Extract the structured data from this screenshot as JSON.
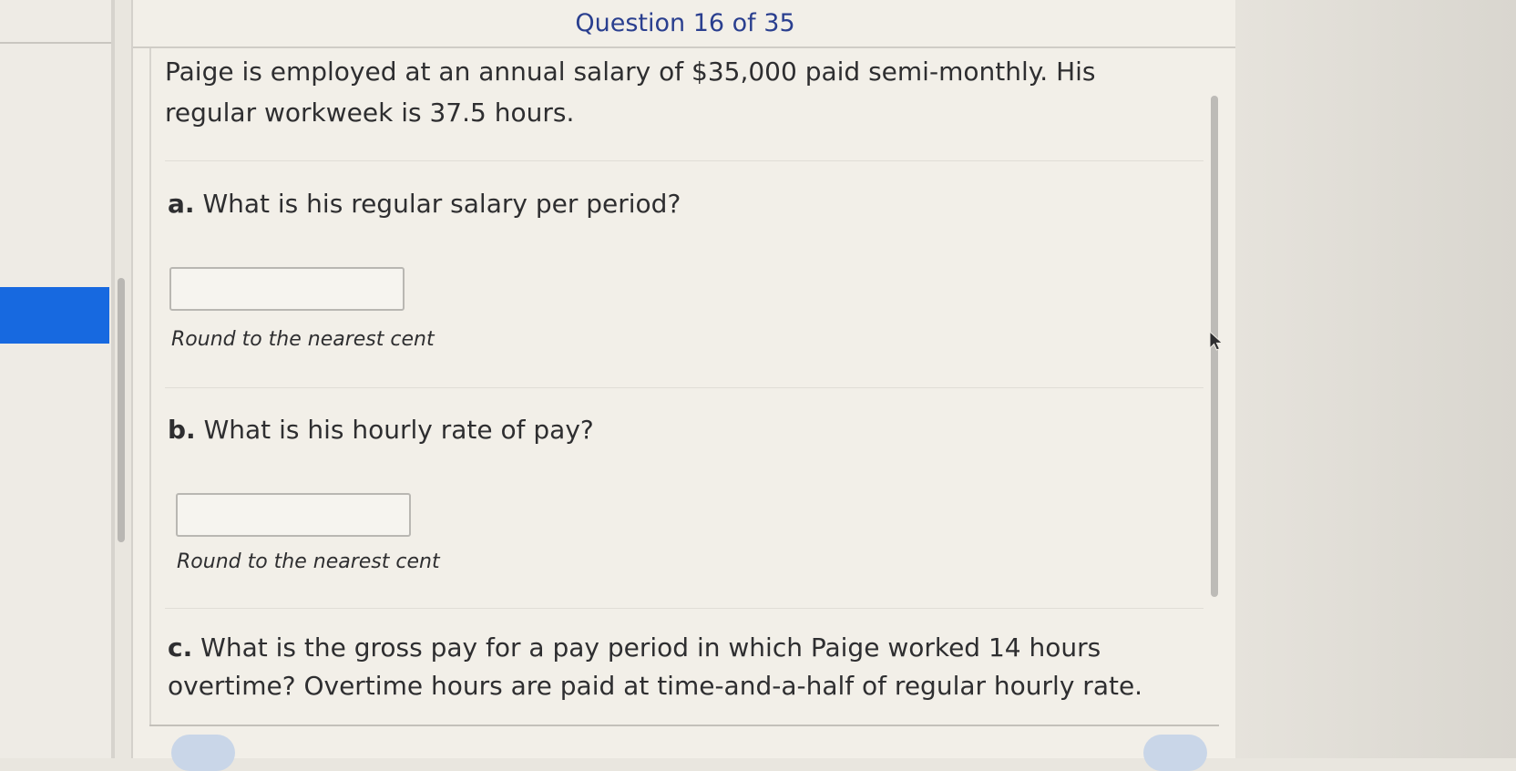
{
  "header": {
    "question_counter": "Question 16 of 35"
  },
  "question": {
    "prompt": "Paige is employed at an annual salary of $35,000 paid semi-monthly. His regular workweek is 37.5 hours.",
    "parts": [
      {
        "letter": "a.",
        "text": "What is his regular salary per period?",
        "answer_value": "",
        "hint": "Round to the nearest cent"
      },
      {
        "letter": "b.",
        "text": "What is his hourly rate of pay?",
        "answer_value": "",
        "hint": "Round to the nearest cent"
      },
      {
        "letter": "c.",
        "text": "What is the gross pay for a pay period in which Paige worked 14 hours overtime? Overtime hours are paid at time-and-a-half of regular hourly rate."
      }
    ]
  },
  "colors": {
    "accent": "#1769e0",
    "header_text": "#2a3f8f",
    "card_bg": "#f2efe8"
  }
}
